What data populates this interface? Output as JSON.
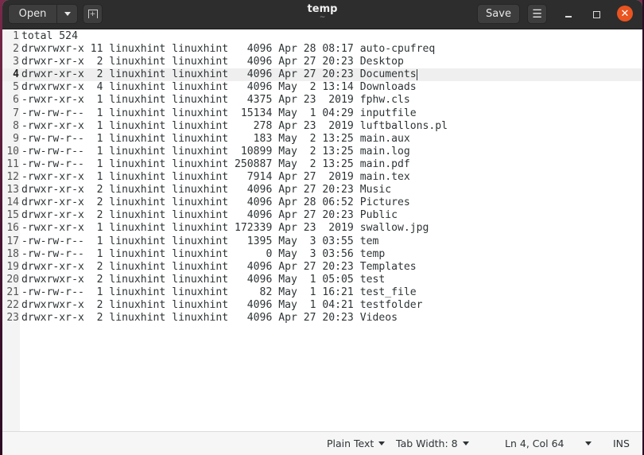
{
  "window": {
    "title": "temp",
    "subtitle": "~"
  },
  "headerbar": {
    "open_label": "Open",
    "open_menu_icon": "chevron-down-icon",
    "new_tab_icon": "new-document-icon",
    "save_label": "Save",
    "menu_icon": "hamburger-menu-icon",
    "minimize_icon": "minimize-icon",
    "maximize_icon": "maximize-icon",
    "close_icon": "close-icon",
    "close_color": "#e95420"
  },
  "editor": {
    "current_line": 4,
    "lines": [
      {
        "num": "1",
        "text": "total 524"
      },
      {
        "num": "2",
        "text": "drwxrwxr-x 11 linuxhint linuxhint   4096 Apr 28 08:17 auto-cpufreq"
      },
      {
        "num": "3",
        "text": "drwxr-xr-x  2 linuxhint linuxhint   4096 Apr 27 20:23 Desktop"
      },
      {
        "num": "4",
        "text": "drwxr-xr-x  2 linuxhint linuxhint   4096 Apr 27 20:23 Documents"
      },
      {
        "num": "5",
        "text": "drwxrwxr-x  4 linuxhint linuxhint   4096 May  2 13:14 Downloads"
      },
      {
        "num": "6",
        "text": "-rwxr-xr-x  1 linuxhint linuxhint   4375 Apr 23  2019 fphw.cls"
      },
      {
        "num": "7",
        "text": "-rw-rw-r--  1 linuxhint linuxhint  15134 May  1 04:29 inputfile"
      },
      {
        "num": "8",
        "text": "-rwxr-xr-x  1 linuxhint linuxhint    278 Apr 23  2019 luftballons.pl"
      },
      {
        "num": "9",
        "text": "-rw-rw-r--  1 linuxhint linuxhint    183 May  2 13:25 main.aux"
      },
      {
        "num": "10",
        "text": "-rw-rw-r--  1 linuxhint linuxhint  10899 May  2 13:25 main.log"
      },
      {
        "num": "11",
        "text": "-rw-rw-r--  1 linuxhint linuxhint 250887 May  2 13:25 main.pdf"
      },
      {
        "num": "12",
        "text": "-rwxr-xr-x  1 linuxhint linuxhint   7914 Apr 27  2019 main.tex"
      },
      {
        "num": "13",
        "text": "drwxr-xr-x  2 linuxhint linuxhint   4096 Apr 27 20:23 Music"
      },
      {
        "num": "14",
        "text": "drwxr-xr-x  2 linuxhint linuxhint   4096 Apr 28 06:52 Pictures"
      },
      {
        "num": "15",
        "text": "drwxr-xr-x  2 linuxhint linuxhint   4096 Apr 27 20:23 Public"
      },
      {
        "num": "16",
        "text": "-rwxr-xr-x  1 linuxhint linuxhint 172339 Apr 23  2019 swallow.jpg"
      },
      {
        "num": "17",
        "text": "-rw-rw-r--  1 linuxhint linuxhint   1395 May  3 03:55 tem"
      },
      {
        "num": "18",
        "text": "-rw-rw-r--  1 linuxhint linuxhint      0 May  3 03:56 temp"
      },
      {
        "num": "19",
        "text": "drwxr-xr-x  2 linuxhint linuxhint   4096 Apr 27 20:23 Templates"
      },
      {
        "num": "20",
        "text": "drwxrwxr-x  2 linuxhint linuxhint   4096 May  1 05:05 test"
      },
      {
        "num": "21",
        "text": "-rw-rw-r--  1 linuxhint linuxhint     82 May  1 16:21 test_file"
      },
      {
        "num": "22",
        "text": "drwxrwxr-x  2 linuxhint linuxhint   4096 May  1 04:21 testfolder"
      },
      {
        "num": "23",
        "text": "drwxr-xr-x  2 linuxhint linuxhint   4096 Apr 27 20:23 Videos"
      }
    ]
  },
  "statusbar": {
    "language": "Plain Text",
    "tab_width": "Tab Width: 8",
    "position": "Ln 4, Col 64",
    "insert_mode": "INS"
  }
}
